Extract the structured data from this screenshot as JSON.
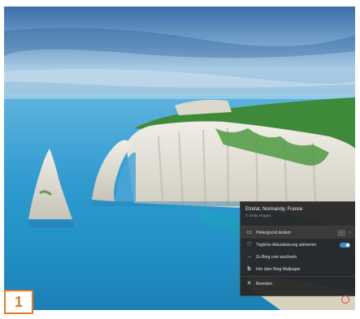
{
  "step_badge": "1",
  "context_menu": {
    "location_title": "Étretat, Normandy, France",
    "location_subtitle": "© Getty Images",
    "items": [
      {
        "icon": "image-icon",
        "label": "Hintergrund ändern",
        "has_button": true,
        "button_label": "›",
        "has_chevron": true
      },
      {
        "icon": "heart-icon",
        "label": "Tägliche Aktualisierung aktivieren",
        "has_toggle": true,
        "toggle_on": true
      },
      {
        "icon": "arrow-right-icon",
        "label": "Zu Bing.com wechseln"
      },
      {
        "icon": "bing-icon",
        "label": "Info über Bing Wallpaper"
      },
      {
        "icon": "close-icon",
        "label": "Beenden"
      }
    ]
  },
  "colors": {
    "menu_bg": "#282828",
    "toggle_on": "#3a8fd6",
    "badge_accent": "#e0792a"
  }
}
